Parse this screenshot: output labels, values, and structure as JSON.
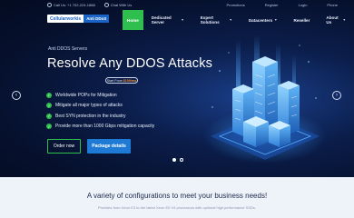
{
  "topbar": {
    "phone": "Call Us: +1 702-224-1888",
    "chat": "Chat With Us",
    "links": [
      "Promotions",
      "Register",
      "Login",
      "Phone"
    ]
  },
  "logo": {
    "main": "Cellularworkis",
    "tag": "Anti DDoS"
  },
  "nav": {
    "items": [
      {
        "label": "Home",
        "active": true,
        "caret": false
      },
      {
        "label": "Dedicated Server",
        "active": false,
        "caret": true
      },
      {
        "label": "Expert Solutions",
        "active": false,
        "caret": true
      },
      {
        "label": "Datacenters",
        "active": false,
        "caret": true
      },
      {
        "label": "Reseller",
        "active": false,
        "caret": false
      },
      {
        "label": "About Us",
        "active": false,
        "caret": true
      }
    ]
  },
  "hero": {
    "eyebrow": "Anti DDOS Servers",
    "headline": "Resolve Any DDOS Attacks",
    "start_prefix": "Start From",
    "start_price": "$109/mo",
    "features": [
      "Worldwide POPs for Mitigation",
      "Mitigate all major types of attacks",
      "Best SYN protection in the industry",
      "Provide more than 1000 Gbps mitigation capacity"
    ],
    "order_button": "Order now",
    "package_button": "Package details",
    "slides": 2,
    "active_slide": 1
  },
  "colors": {
    "accent_green": "#2fbf4e",
    "accent_blue": "#1f7ad6",
    "price_orange": "#ff9a3c",
    "hero_bg": "#06112e"
  },
  "section": {
    "title": "A variety of configurations to meet your business needs!",
    "subtitle": "Provides from Xeon E3 to the latest Xeon E5 V4 processors with optional high performance SSDs."
  }
}
